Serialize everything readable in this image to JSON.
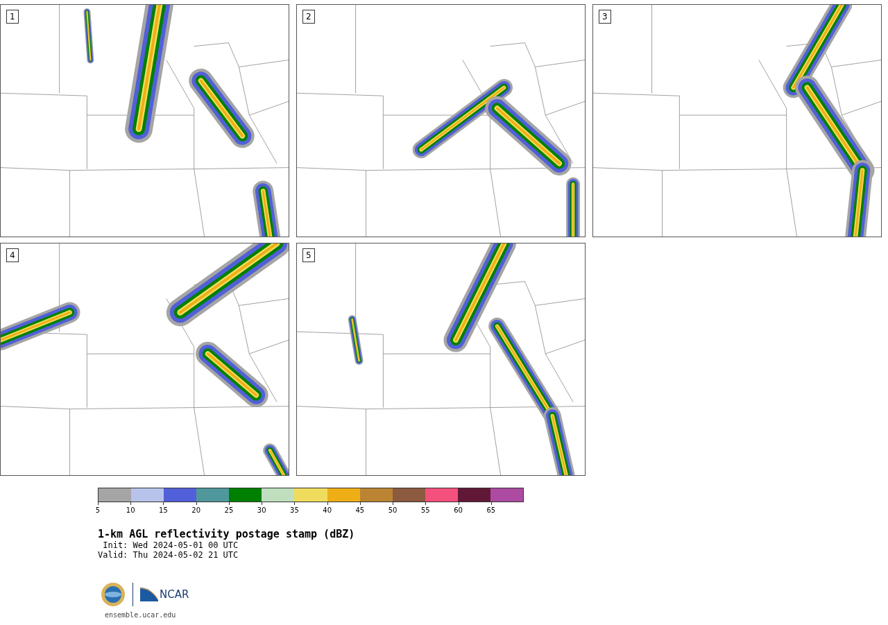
{
  "panels": [
    {
      "label": "1"
    },
    {
      "label": "2"
    },
    {
      "label": "3"
    },
    {
      "label": "4"
    },
    {
      "label": "5"
    }
  ],
  "colorbar": [
    {
      "label": "5",
      "color": "#a5a5a5"
    },
    {
      "label": "10",
      "color": "#b8c3ec"
    },
    {
      "label": "15",
      "color": "#5160d8"
    },
    {
      "label": "20",
      "color": "#50979c"
    },
    {
      "label": "25",
      "color": "#008000"
    },
    {
      "label": "30",
      "color": "#bfdfbf"
    },
    {
      "label": "35",
      "color": "#f0dc5c"
    },
    {
      "label": "40",
      "color": "#f0ae16"
    },
    {
      "label": "45",
      "color": "#bb8432"
    },
    {
      "label": "50",
      "color": "#8b5a3f"
    },
    {
      "label": "55",
      "color": "#f4507e"
    },
    {
      "label": "60",
      "color": "#611836"
    },
    {
      "label": "65",
      "color": "#ad4ba2"
    }
  ],
  "title": "1-km AGL reflectivity postage stamp (dBZ)",
  "init": " Init: Wed 2024-05-01 00 UTC",
  "valid": "Valid: Thu 2024-05-02 21 UTC",
  "logo_text": "NCAR",
  "url": "ensemble.ucar.edu"
}
